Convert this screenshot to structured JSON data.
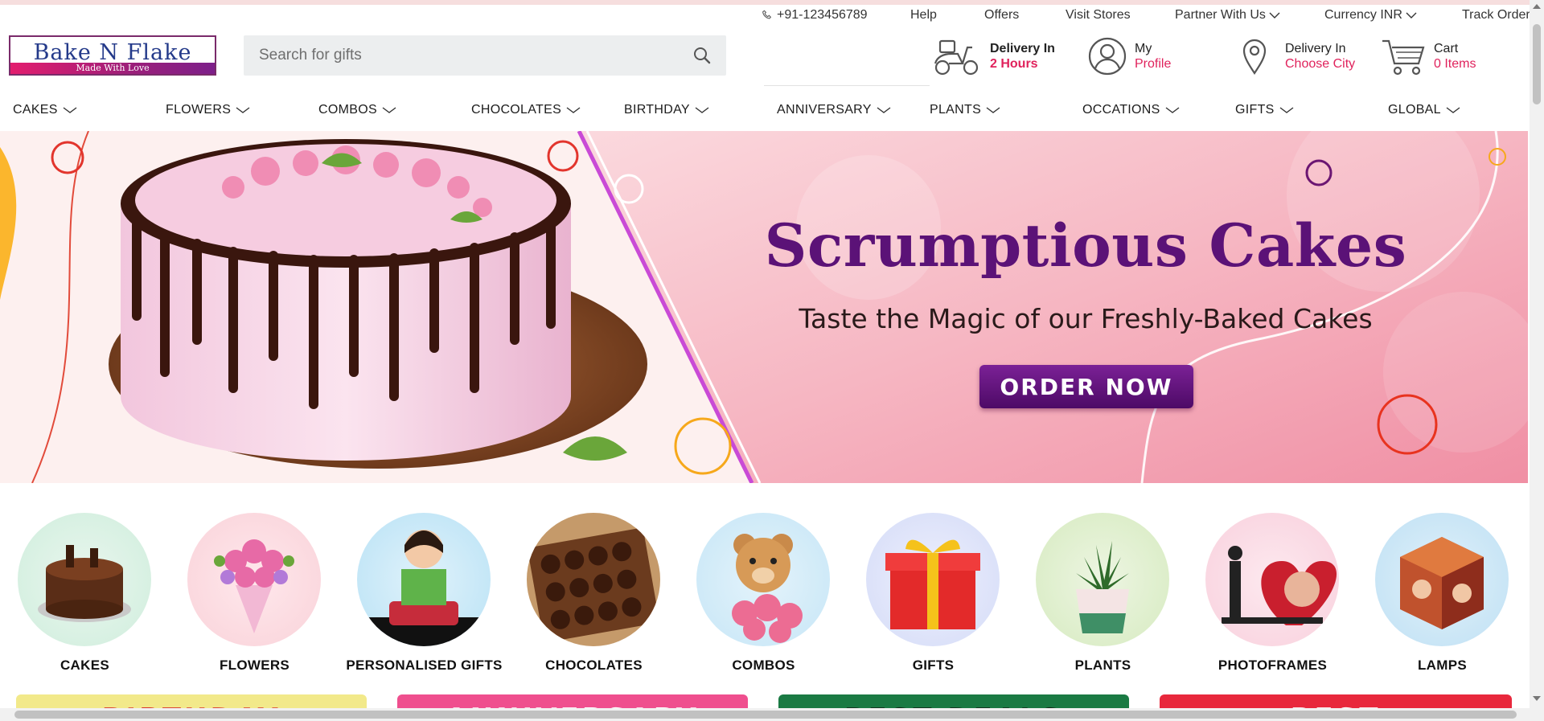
{
  "colors": {
    "accent": "#e0225c",
    "brand_purple": "#5b1277",
    "logo_blue": "#243a8a"
  },
  "utility": {
    "phone": "+91-123456789",
    "help": "Help",
    "offers": "Offers",
    "visit_stores": "Visit Stores",
    "partner": "Partner With Us",
    "currency": "Currency INR",
    "track_order": "Track Order"
  },
  "logo": {
    "name": "Bake N Flake",
    "tagline": "Made With Love"
  },
  "search": {
    "placeholder": "Search for gifts"
  },
  "header": {
    "delivery_fast": {
      "line1": "Delivery In",
      "line2": "2 Hours",
      "icon": "scooter-icon"
    },
    "profile": {
      "line1": "My",
      "line2": "Profile",
      "icon": "user-icon"
    },
    "delivery_city": {
      "line1": "Delivery In",
      "line2": "Choose City",
      "icon": "location-pin-icon"
    },
    "cart": {
      "line1": "Cart",
      "line2": "0 Items",
      "icon": "cart-icon"
    }
  },
  "nav": [
    "CAKES",
    "FLOWERS",
    "COMBOS",
    "CHOCOLATES",
    "BIRTHDAY",
    "ANNIVERSARY",
    "PLANTS",
    "OCCATIONS",
    "GIFTS",
    "GLOBAL"
  ],
  "banner": {
    "title": "Scrumptious Cakes",
    "subtitle": "Taste the Magic of our Freshly-Baked Cakes",
    "cta": "ORDER NOW"
  },
  "categories": [
    "CAKES",
    "FLOWERS",
    "PERSONALISED GIFTS",
    "CHOCOLATES",
    "COMBOS",
    "GIFTS",
    "PLANTS",
    "PHOTOFRAMES",
    "LAMPS"
  ],
  "promos": [
    "BIRTHDAY",
    "ANNIVERSARY",
    "BEST DEALS",
    "BEST"
  ]
}
